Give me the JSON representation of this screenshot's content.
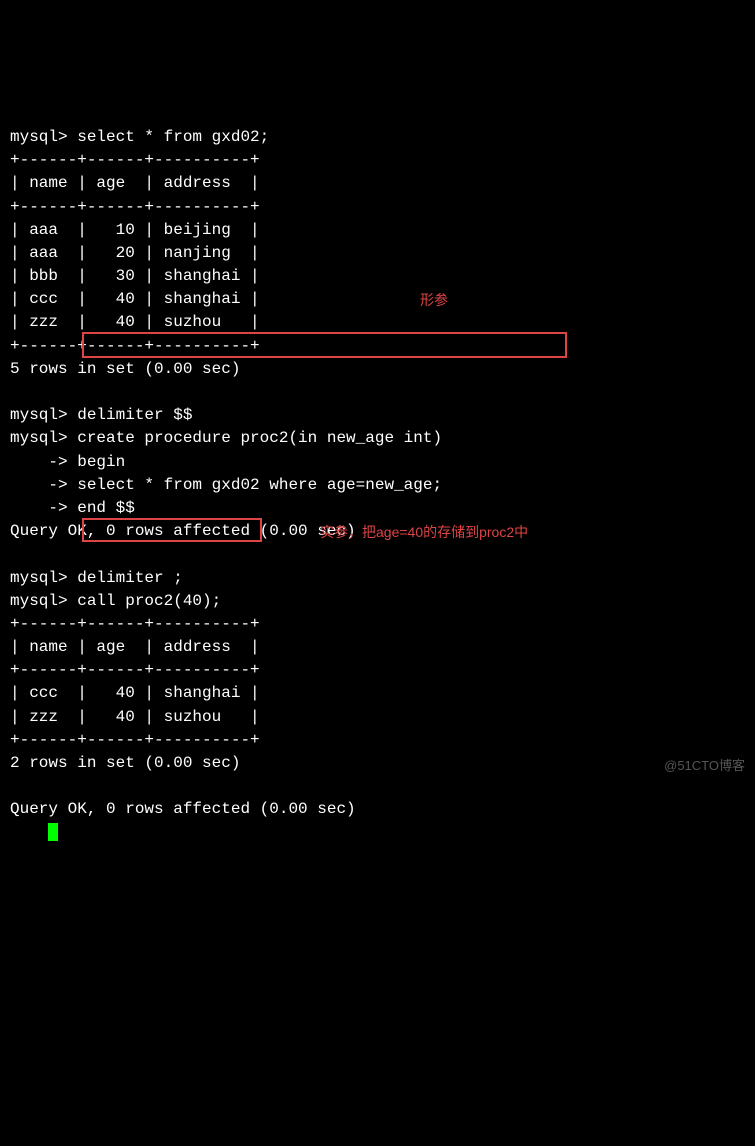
{
  "terminal": {
    "l1": "mysql> select * from gxd02;",
    "l2": "+------+------+----------+",
    "l3": "| name | age  | address  |",
    "l4": "+------+------+----------+",
    "l5": "| aaa  |   10 | beijing  |",
    "l6": "| aaa  |   20 | nanjing  |",
    "l7": "| bbb  |   30 | shanghai |",
    "l8": "| ccc  |   40 | shanghai |",
    "l9": "| zzz  |   40 | suzhou   |",
    "l10": "+------+------+----------+",
    "l11": "5 rows in set (0.00 sec)",
    "l12": "",
    "l13": "mysql> delimiter $$",
    "l14": "mysql> create procedure proc2(in new_age int)",
    "l15": "    -> begin",
    "l16": "    -> select * from gxd02 where age=new_age;",
    "l17": "    -> end $$",
    "l18": "Query OK, 0 rows affected (0.00 sec)",
    "l19": "",
    "l20": "mysql> delimiter ;",
    "l21": "mysql> call proc2(40);",
    "l22": "+------+------+----------+",
    "l23": "| name | age  | address  |",
    "l24": "+------+------+----------+",
    "l25": "| ccc  |   40 | shanghai |",
    "l26": "| zzz  |   40 | suzhou   |",
    "l27": "+------+------+----------+",
    "l28": "2 rows in set (0.00 sec)",
    "l29": "",
    "l30": "Query OK, 0 rows affected (0.00 sec)",
    "l31": ""
  },
  "annotations": {
    "a1": "形参",
    "a2": "实参，把age=40的存储到proc2中"
  },
  "watermark": "@51CTO博客"
}
